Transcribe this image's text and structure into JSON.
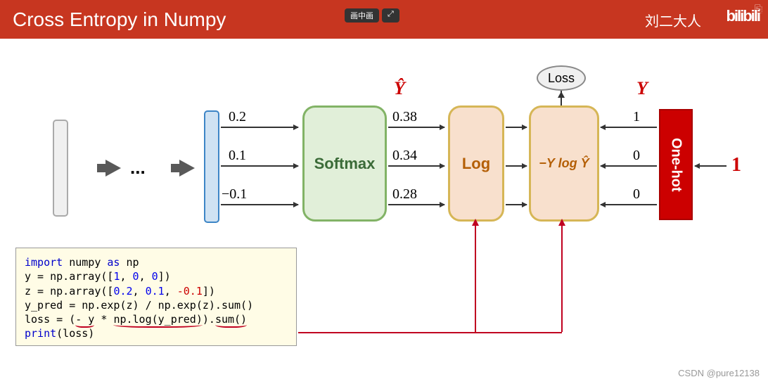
{
  "header": {
    "title": "Cross Entropy in Numpy",
    "pip_label": "画中画",
    "author": "刘二大人",
    "logo": "bilibili"
  },
  "diagram": {
    "dots": "...",
    "softmax_label": "Softmax",
    "log_label": "Log",
    "formula_label": "−Y log Ŷ",
    "loss_label": "Loss",
    "onehot_label": "One-hot",
    "yhat_label": "Ŷ",
    "y_label": "Y",
    "one_input": "1",
    "z_values": [
      "0.2",
      "0.1",
      "−0.1"
    ],
    "yhat_values": [
      "0.38",
      "0.34",
      "0.28"
    ],
    "y_values": [
      "1",
      "0",
      "0"
    ]
  },
  "code": {
    "l1_import": "import",
    "l1_rest": " numpy ",
    "l1_as": "as",
    "l1_np": " np",
    "l2_a": "y = np.array([",
    "l2_v1": "1",
    "l2_c1": ", ",
    "l2_v2": "0",
    "l2_c2": ", ",
    "l2_v3": "0",
    "l2_b": "])",
    "l3_a": "z = np.array([",
    "l3_v1": "0.2",
    "l3_c1": ", ",
    "l3_v2": "0.1",
    "l3_c2": ", ",
    "l3_v3": "-0.1",
    "l3_b": "])",
    "l4": "y_pred = np.exp(z) / np.exp(z).sum()",
    "l5_a": "loss = (",
    "l5_u1": "- y",
    "l5_b": " * ",
    "l5_u2": "np.log(y_pred)",
    "l5_c": ").",
    "l5_u3": "sum()",
    "l6_a": "print",
    "l6_b": "(loss)"
  },
  "watermark": "CSDN @pure12138"
}
